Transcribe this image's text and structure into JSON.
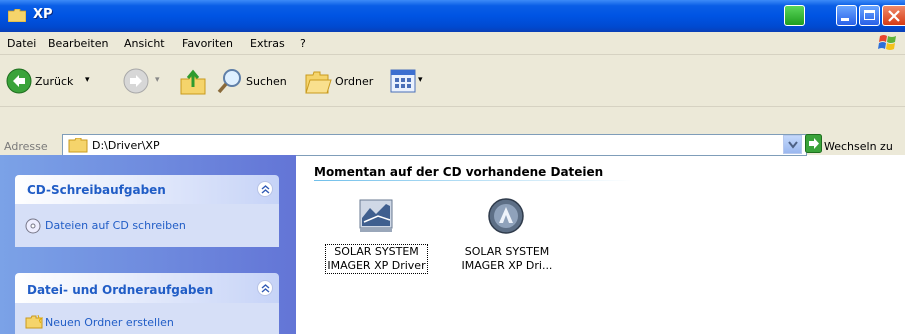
{
  "window": {
    "title": "XP"
  },
  "menu": {
    "items": [
      "Datei",
      "Bearbeiten",
      "Ansicht",
      "Favoriten",
      "Extras",
      "?"
    ]
  },
  "toolbar": {
    "back_label": "Zurück",
    "search_label": "Suchen",
    "folders_label": "Ordner"
  },
  "address": {
    "label": "Adresse",
    "value": "D:\\Driver\\XP",
    "go_label": "Wechseln zu"
  },
  "taskpane": {
    "cd_panel": {
      "title": "CD-Schreibaufgaben",
      "tasks": [
        "Dateien auf CD schreiben"
      ]
    },
    "folder_panel": {
      "title": "Datei- und Ordneraufgaben",
      "tasks": [
        "Neuen Ordner erstellen"
      ]
    }
  },
  "content": {
    "group_title": "Momentan auf der CD vorhandene Dateien",
    "files": [
      {
        "line1": "SOLAR SYSTEM",
        "line2": "IMAGER XP Driver",
        "icon": "installer-icon",
        "selected": true
      },
      {
        "line1": "SOLAR SYSTEM",
        "line2": "IMAGER XP Dri...",
        "icon": "setup-disc-icon",
        "selected": false
      }
    ]
  },
  "colors": {
    "titlebar": "#0054e3",
    "link": "#215dc6",
    "taskpane": "#7ba2e7"
  }
}
